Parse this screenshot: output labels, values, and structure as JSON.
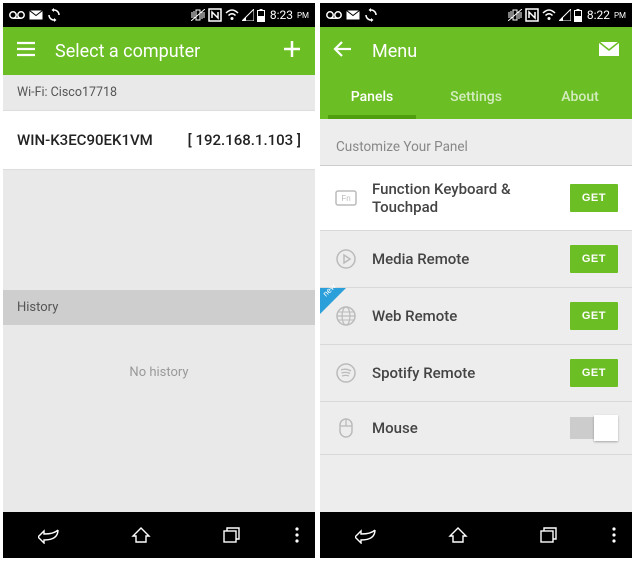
{
  "left": {
    "statusbar": {
      "time": "8:23",
      "ampm": "PM"
    },
    "actionbar": {
      "title": "Select a computer"
    },
    "wifi_label": "Wi-Fi: Cisco17718",
    "computer": {
      "name": "WIN-K3EC90EK1VM",
      "ip": "[ 192.168.1.103 ]"
    },
    "history_header": "History",
    "no_history": "No history"
  },
  "right": {
    "statusbar": {
      "time": "8:22",
      "ampm": "PM"
    },
    "actionbar": {
      "title": "Menu"
    },
    "tabs": {
      "panels": "Panels",
      "settings": "Settings",
      "about": "About"
    },
    "section_title": "Customize Your Panel",
    "panels": {
      "p0": {
        "label": "Function Keyboard & Touchpad",
        "action": "GET"
      },
      "p1": {
        "label": "Media Remote",
        "action": "GET"
      },
      "p2": {
        "label": "Web Remote",
        "action": "GET",
        "new": "new"
      },
      "p3": {
        "label": "Spotify Remote",
        "action": "GET"
      },
      "p4": {
        "label": "Mouse"
      }
    }
  }
}
